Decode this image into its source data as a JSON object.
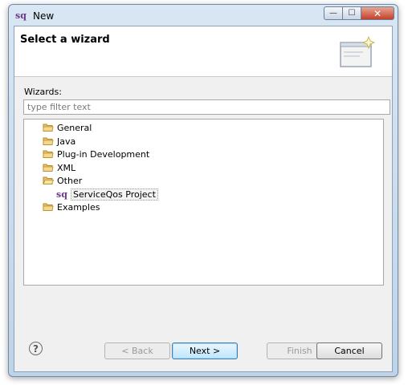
{
  "window": {
    "title": "New",
    "app_icon": "sq-logo-icon"
  },
  "banner": {
    "title": "Select a wizard",
    "icon": "new-wizard-icon"
  },
  "wizards": {
    "label": "Wizards:",
    "filter": {
      "value": "",
      "placeholder": "type filter text"
    }
  },
  "tree": [
    {
      "label": "General",
      "icon": "folder-icon",
      "level": 0
    },
    {
      "label": "Java",
      "icon": "folder-icon",
      "level": 0
    },
    {
      "label": "Plug-in Development",
      "icon": "folder-icon",
      "level": 0
    },
    {
      "label": "XML",
      "icon": "folder-icon",
      "level": 0
    },
    {
      "label": "Other",
      "icon": "folder-open-icon",
      "level": 0
    },
    {
      "label": "ServiceQos Project",
      "icon": "sq-project-icon",
      "level": 1,
      "selected": true
    },
    {
      "label": "Examples",
      "icon": "folder-icon",
      "level": 0
    }
  ],
  "buttons": {
    "back": "< Back",
    "next": "Next >",
    "finish": "Finish",
    "cancel": "Cancel",
    "help_glyph": "?"
  },
  "icons": {
    "app_glyph": "sq",
    "minimize_glyph": "—",
    "maximize_glyph": "☐",
    "close_glyph": "✕"
  },
  "colors": {
    "folder": "#e9c46a",
    "folder_dark": "#b48a2c",
    "brand": "#6b3a8a"
  }
}
